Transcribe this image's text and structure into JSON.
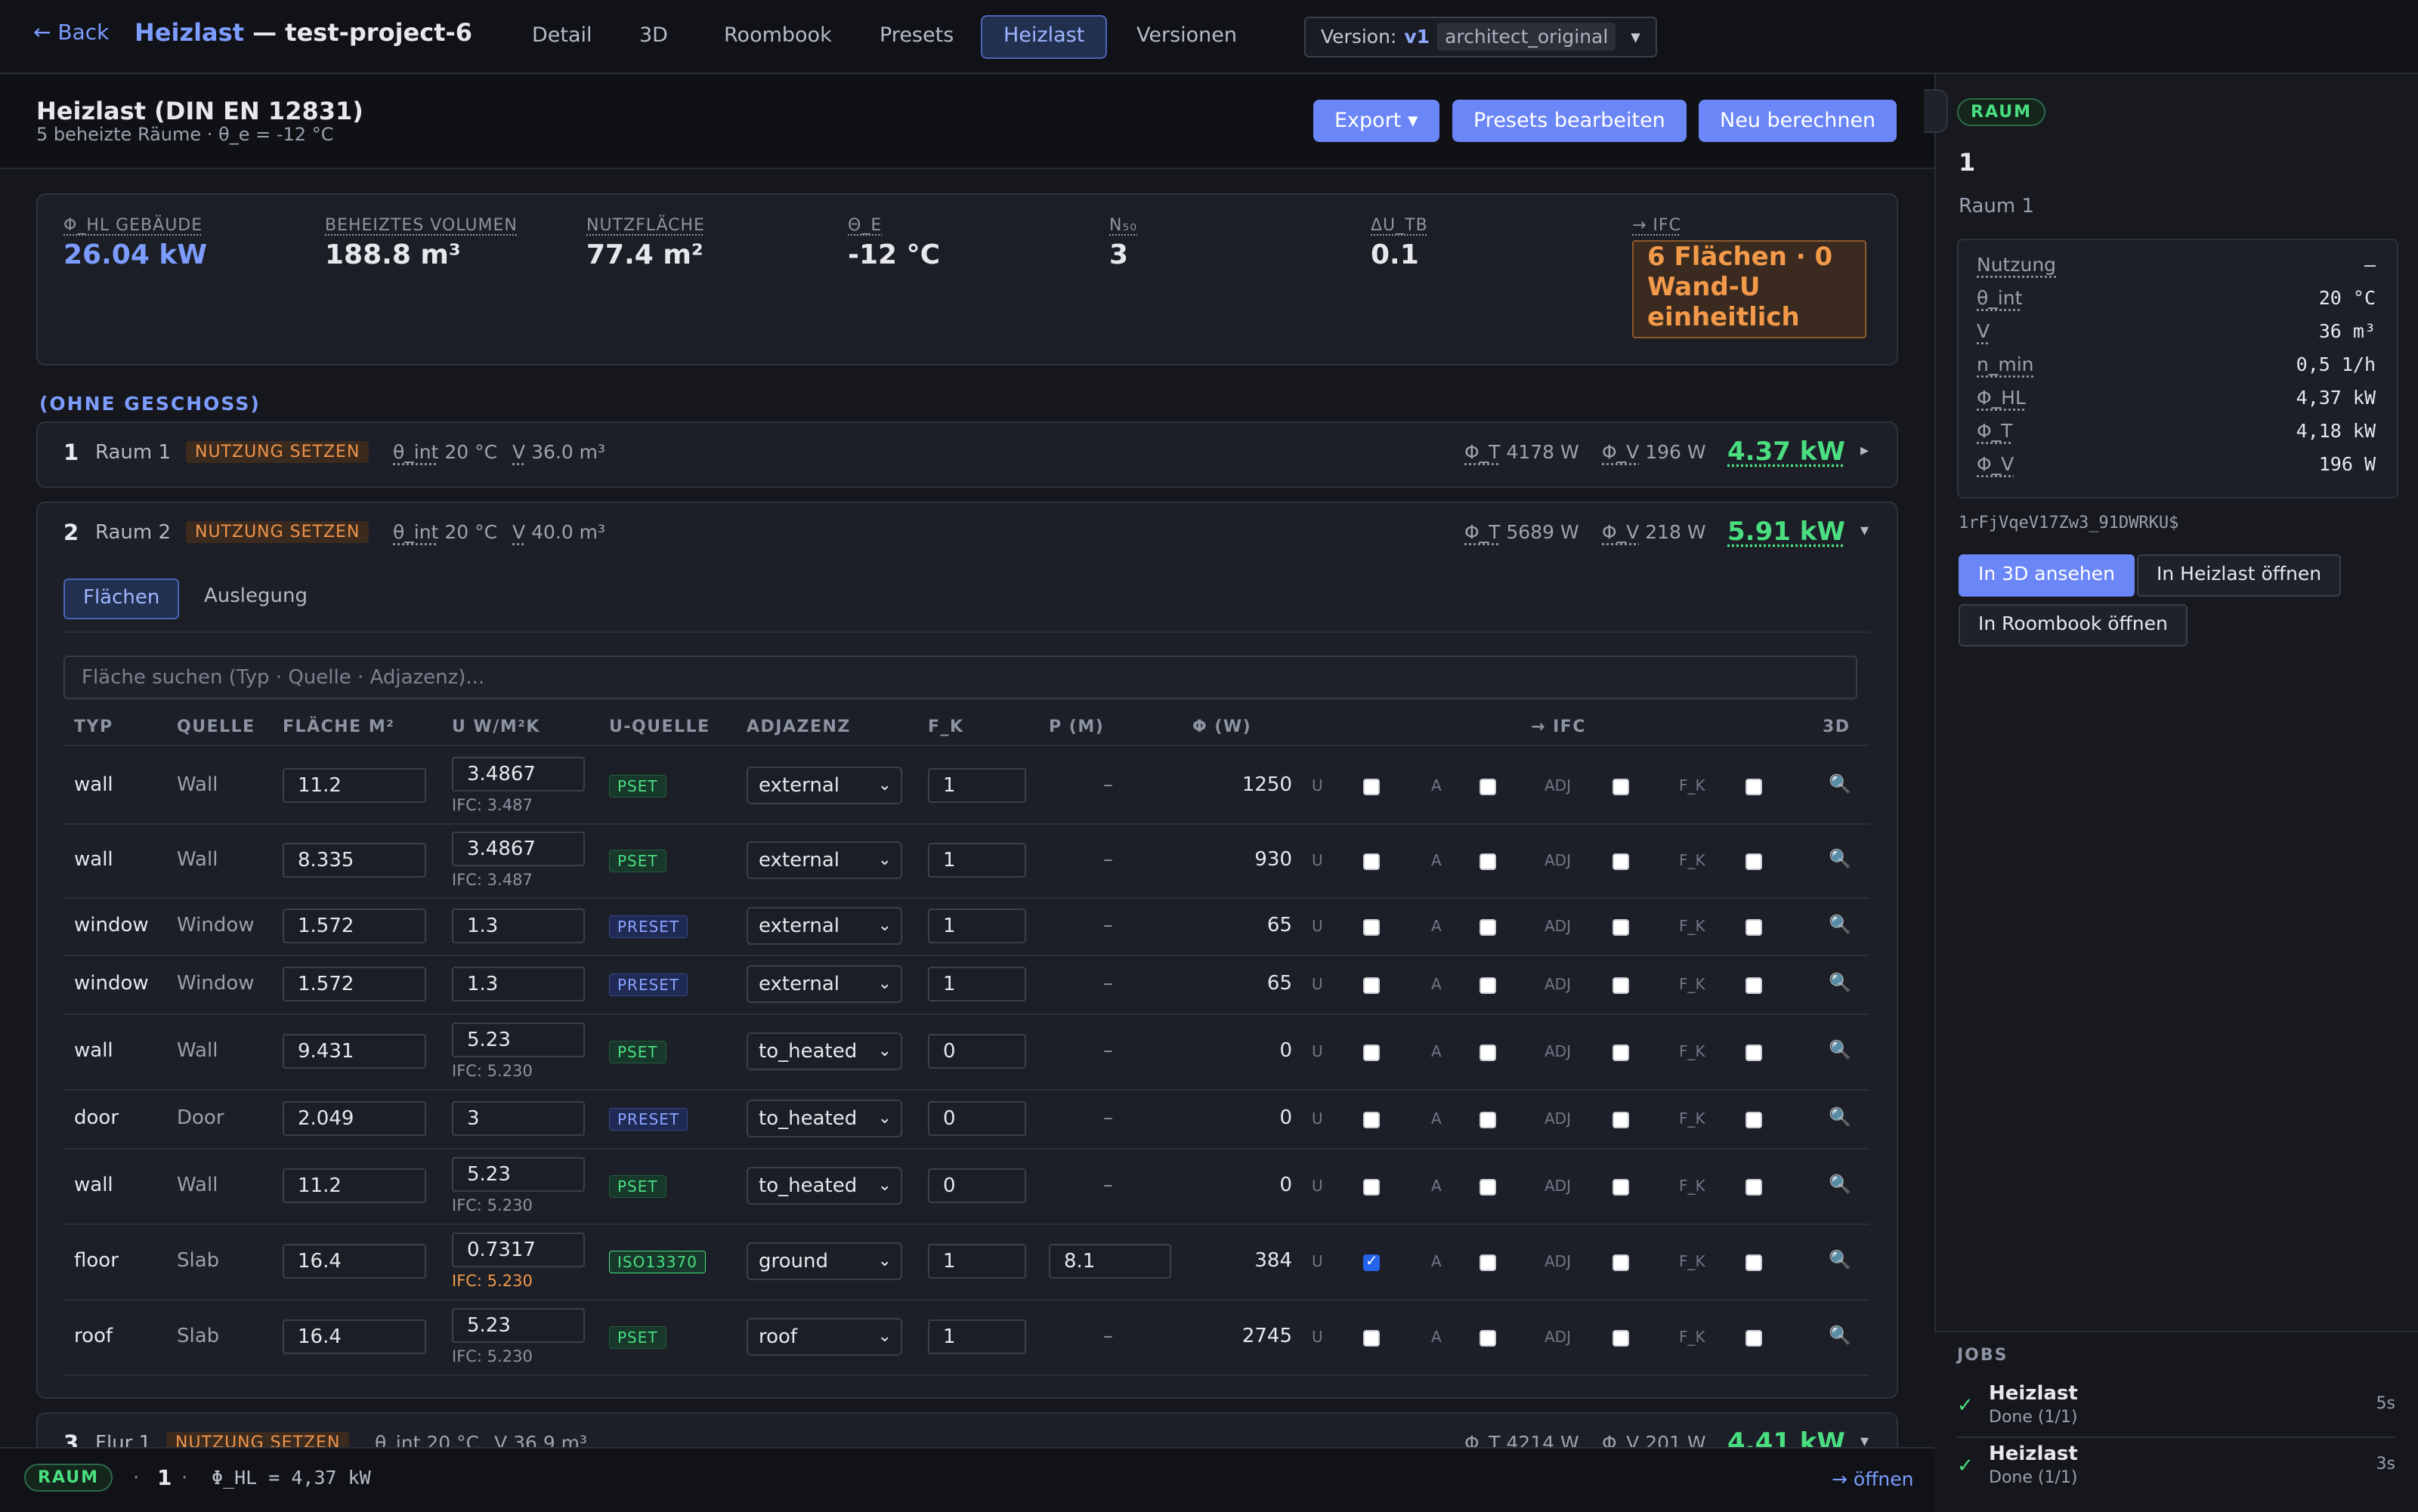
{
  "topbar": {
    "back": "← Back",
    "title_prefix": "Heizlast",
    "title_suffix": " — test-project-6",
    "tabs": [
      "Detail",
      "3D",
      "Roombook",
      "Presets",
      "Heizlast",
      "Versionen"
    ],
    "active_tab": "Heizlast",
    "version_label": "Version:",
    "version_value": "v1",
    "version_tag": "architect_original",
    "version_arrow": "▾"
  },
  "header": {
    "title": "Heizlast (DIN EN 12831)",
    "subtitle": "5 beheizte Räume · θ_e = -12 °C",
    "export": "Export ▾",
    "presets": "Presets bearbeiten",
    "recalc": "Neu berechnen"
  },
  "summary": {
    "stats": [
      {
        "label": "Φ_HL GEBÄUDE",
        "value": "26.04 kW",
        "color": "#7c9cff"
      },
      {
        "label": "BEHEIZTES VOLUMEN",
        "value": "188.8 m³"
      },
      {
        "label": "NUTZFLÄCHE",
        "value": "77.4 m²"
      },
      {
        "label": "Θ_E",
        "value": "-12 °C"
      },
      {
        "label": "N₅₀",
        "value": "3"
      },
      {
        "label": "ΔU_TB",
        "value": "0.1"
      }
    ],
    "ifc_label": "→ IFC",
    "ifc_value": "6 Flächen · 0 Wand-U einheitlich"
  },
  "group": "(OHNE GESCHOSS)",
  "rooms": [
    {
      "num": "1",
      "name": "Raum 1",
      "badge": "NUTZUNG SETZEN",
      "theta_k": "θ_int",
      "theta_v": "20 °C",
      "v_k": "V",
      "v_v": "36.0 m³",
      "phi_t_k": "Φ_T",
      "phi_t_v": "4178 W",
      "phi_v_k": "Φ_V",
      "phi_v_v": "196 W",
      "kw": "4.37 kW",
      "chev": "▸"
    },
    {
      "num": "2",
      "name": "Raum 2",
      "badge": "NUTZUNG SETZEN",
      "theta_k": "θ_int",
      "theta_v": "20 °C",
      "v_k": "V",
      "v_v": "40.0 m³",
      "phi_t_k": "Φ_T",
      "phi_t_v": "5689 W",
      "phi_v_k": "Φ_V",
      "phi_v_v": "218 W",
      "kw": "5.91 kW",
      "chev": "▾"
    },
    {
      "num": "3",
      "name": "Flur 1",
      "badge": "NUTZUNG SETZEN",
      "theta_k": "θ_int",
      "theta_v": "20 °C",
      "v_k": "V",
      "v_v": "36.9 m³",
      "phi_t_k": "Φ_T",
      "phi_t_v": "4214 W",
      "phi_v_k": "Φ_V",
      "phi_v_v": "201 W",
      "kw": "4.41 kW",
      "chev": "▾"
    }
  ],
  "subtabs": [
    "Flächen",
    "Auslegung"
  ],
  "search_placeholder": "Fläche suchen (Typ · Quelle · Adjazenz)...",
  "table": {
    "headers": [
      "TYP",
      "QUELLE",
      "FLÄCHE M²",
      "U W/M²K",
      "U-QUELLE",
      "ADJAZENZ",
      "F_K",
      "P (M)",
      "Φ (W)",
      "→ IFC",
      "3D"
    ],
    "flag_labels": [
      "U",
      "A",
      "ADJ",
      "F_K"
    ],
    "rows": [
      {
        "typ": "wall",
        "quelle": "Wall",
        "flaeche": "11.2",
        "u": "3.4867",
        "ifc": "IFC: 3.487",
        "usrc": "PSET",
        "adj": "external",
        "fk": "1",
        "p": "–",
        "phi": "1250",
        "u_checked": false
      },
      {
        "typ": "wall",
        "quelle": "Wall",
        "flaeche": "8.335",
        "u": "3.4867",
        "ifc": "IFC: 3.487",
        "usrc": "PSET",
        "adj": "external",
        "fk": "1",
        "p": "–",
        "phi": "930",
        "u_checked": false
      },
      {
        "typ": "window",
        "quelle": "Window",
        "flaeche": "1.572",
        "u": "1.3",
        "ifc": "",
        "usrc": "PRESET",
        "adj": "external",
        "fk": "1",
        "p": "–",
        "phi": "65",
        "u_checked": false
      },
      {
        "typ": "window",
        "quelle": "Window",
        "flaeche": "1.572",
        "u": "1.3",
        "ifc": "",
        "usrc": "PRESET",
        "adj": "external",
        "fk": "1",
        "p": "–",
        "phi": "65",
        "u_checked": false
      },
      {
        "typ": "wall",
        "quelle": "Wall",
        "flaeche": "9.431",
        "u": "5.23",
        "ifc": "IFC: 5.230",
        "usrc": "PSET",
        "adj": "to_heated",
        "fk": "0",
        "p": "–",
        "phi": "0",
        "u_checked": false
      },
      {
        "typ": "door",
        "quelle": "Door",
        "flaeche": "2.049",
        "u": "3",
        "ifc": "",
        "usrc": "PRESET",
        "adj": "to_heated",
        "fk": "0",
        "p": "–",
        "phi": "0",
        "u_checked": false
      },
      {
        "typ": "wall",
        "quelle": "Wall",
        "flaeche": "11.2",
        "u": "5.23",
        "ifc": "IFC: 5.230",
        "usrc": "PSET",
        "adj": "to_heated",
        "fk": "0",
        "p": "–",
        "phi": "0",
        "u_checked": false
      },
      {
        "typ": "floor",
        "quelle": "Slab",
        "flaeche": "16.4",
        "u": "0.7317",
        "ifc": "IFC: 5.230",
        "ifc_warn": true,
        "usrc": "ISO13370",
        "adj": "ground",
        "fk": "1",
        "p": "8.1",
        "p_input": true,
        "phi": "384",
        "u_checked": true
      },
      {
        "typ": "roof",
        "quelle": "Slab",
        "flaeche": "16.4",
        "u": "5.23",
        "ifc": "IFC: 5.230",
        "usrc": "PSET",
        "adj": "roof",
        "fk": "1",
        "p": "–",
        "phi": "2745",
        "u_checked": false
      }
    ]
  },
  "panel": {
    "badge": "RAUM",
    "id": "1",
    "name": "Raum 1",
    "props": [
      {
        "k": "Nutzung",
        "v": "–"
      },
      {
        "k": "θ_int",
        "v": "20 °C"
      },
      {
        "k": "V",
        "v": "36 m³"
      },
      {
        "k": "n_min",
        "v": "0,5 1/h"
      },
      {
        "k": "Φ_HL",
        "v": "4,37 kW"
      },
      {
        "k": "Φ_T",
        "v": "4,18 kW"
      },
      {
        "k": "Φ_V",
        "v": "196 W"
      }
    ],
    "guid": "1rFjVqeV17Zw3_91DWRKU$",
    "btn_3d": "In 3D ansehen",
    "btn_heizlast": "In Heizlast öffnen",
    "btn_roombook": "In Roombook öffnen"
  },
  "jobs": {
    "title": "JOBS",
    "items": [
      {
        "name": "Heizlast",
        "status": "Done (1/1)",
        "duration": "5s"
      },
      {
        "name": "Heizlast",
        "status": "Done (1/1)",
        "duration": "3s"
      }
    ]
  },
  "statusbar": {
    "badge": "RAUM",
    "sep": "·",
    "id": "1",
    "text": "Φ_HL = 4,37 kW",
    "open": "→ öffnen"
  }
}
